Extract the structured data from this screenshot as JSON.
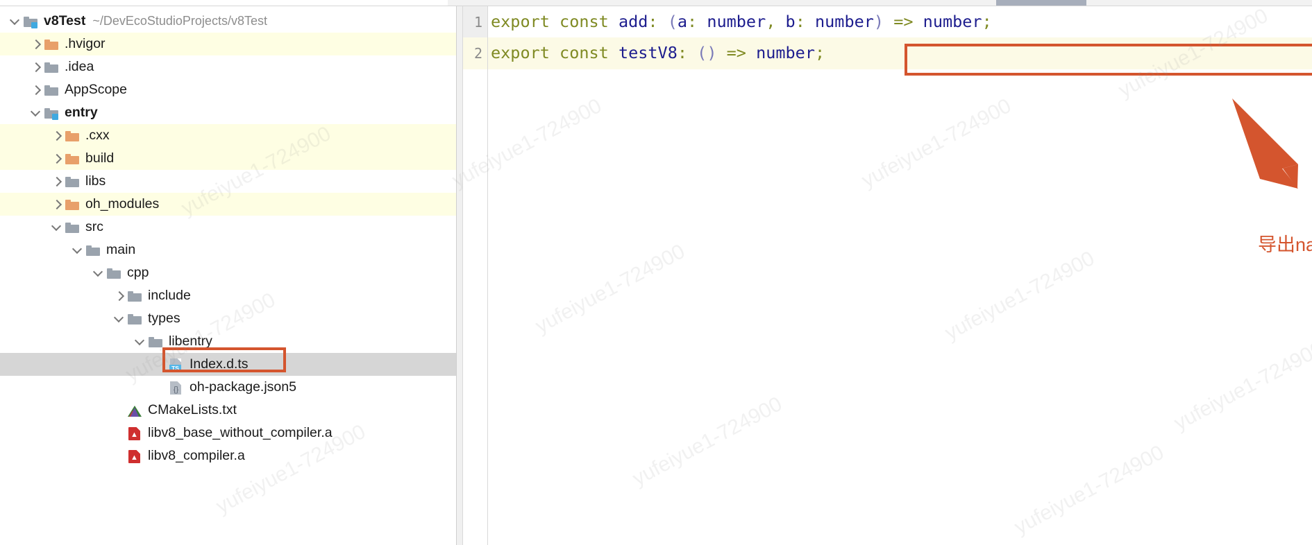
{
  "window": {
    "scrollbar": "horizontal-scrollbar"
  },
  "project_tree": {
    "root": {
      "name": "v8Test",
      "path": "~/DevEcoStudioProjects/v8Test"
    },
    "items": [
      {
        "label": "v8Test",
        "path": "~/DevEcoStudioProjects/v8Test",
        "indent": 0,
        "chevron": "down",
        "icon": "module-folder-icon",
        "bold": true,
        "state": "plain"
      },
      {
        "label": ".hvigor",
        "path": "",
        "indent": 1,
        "chevron": "right",
        "icon": "folder-orange-icon",
        "bold": false,
        "state": "highlight"
      },
      {
        "label": ".idea",
        "path": "",
        "indent": 1,
        "chevron": "right",
        "icon": "folder-gray-icon",
        "bold": false,
        "state": "plain"
      },
      {
        "label": "AppScope",
        "path": "",
        "indent": 1,
        "chevron": "right",
        "icon": "folder-gray-icon",
        "bold": false,
        "state": "plain"
      },
      {
        "label": "entry",
        "path": "",
        "indent": 1,
        "chevron": "down",
        "icon": "module-folder-icon",
        "bold": true,
        "state": "plain"
      },
      {
        "label": ".cxx",
        "path": "",
        "indent": 2,
        "chevron": "right",
        "icon": "folder-orange-icon",
        "bold": false,
        "state": "highlight"
      },
      {
        "label": "build",
        "path": "",
        "indent": 2,
        "chevron": "right",
        "icon": "folder-orange-icon",
        "bold": false,
        "state": "highlight"
      },
      {
        "label": "libs",
        "path": "",
        "indent": 2,
        "chevron": "right",
        "icon": "folder-gray-icon",
        "bold": false,
        "state": "plain"
      },
      {
        "label": "oh_modules",
        "path": "",
        "indent": 2,
        "chevron": "right",
        "icon": "folder-orange-icon",
        "bold": false,
        "state": "highlight"
      },
      {
        "label": "src",
        "path": "",
        "indent": 2,
        "chevron": "down",
        "icon": "folder-gray-icon",
        "bold": false,
        "state": "plain"
      },
      {
        "label": "main",
        "path": "",
        "indent": 3,
        "chevron": "down",
        "icon": "folder-gray-icon",
        "bold": false,
        "state": "plain"
      },
      {
        "label": "cpp",
        "path": "",
        "indent": 4,
        "chevron": "down",
        "icon": "folder-gray-icon",
        "bold": false,
        "state": "plain"
      },
      {
        "label": "include",
        "path": "",
        "indent": 5,
        "chevron": "right",
        "icon": "folder-gray-icon",
        "bold": false,
        "state": "plain"
      },
      {
        "label": "types",
        "path": "",
        "indent": 5,
        "chevron": "down",
        "icon": "folder-gray-icon",
        "bold": false,
        "state": "plain"
      },
      {
        "label": "libentry",
        "path": "",
        "indent": 6,
        "chevron": "down",
        "icon": "folder-gray-icon",
        "bold": false,
        "state": "plain"
      },
      {
        "label": "Index.d.ts",
        "path": "",
        "indent": 7,
        "chevron": "none",
        "icon": "typescript-file-icon",
        "bold": false,
        "state": "selected"
      },
      {
        "label": "oh-package.json5",
        "path": "",
        "indent": 7,
        "chevron": "none",
        "icon": "json5-file-icon",
        "bold": false,
        "state": "plain"
      },
      {
        "label": "CMakeLists.txt",
        "path": "",
        "indent": 5,
        "chevron": "none",
        "icon": "cmake-file-icon",
        "bold": false,
        "state": "plain"
      },
      {
        "label": "libv8_base_without_compiler.a",
        "path": "",
        "indent": 5,
        "chevron": "none",
        "icon": "archive-file-icon",
        "bold": false,
        "state": "plain"
      },
      {
        "label": "libv8_compiler.a",
        "path": "",
        "indent": 5,
        "chevron": "none",
        "icon": "archive-file-icon",
        "bold": false,
        "state": "plain"
      }
    ]
  },
  "editor": {
    "line_numbers": [
      "1",
      "2"
    ],
    "lines": [
      {
        "number": "1",
        "text": "export const add: (a: number, b: number) => number;",
        "tokens": [
          {
            "t": "export",
            "k": "kw"
          },
          {
            "t": " ",
            "k": "plain"
          },
          {
            "t": "const",
            "k": "kw"
          },
          {
            "t": " ",
            "k": "plain"
          },
          {
            "t": "add",
            "k": "id"
          },
          {
            "t": ":",
            "k": "op"
          },
          {
            "t": " ",
            "k": "plain"
          },
          {
            "t": "(",
            "k": "punct"
          },
          {
            "t": "a",
            "k": "id"
          },
          {
            "t": ":",
            "k": "op"
          },
          {
            "t": " ",
            "k": "plain"
          },
          {
            "t": "number",
            "k": "id"
          },
          {
            "t": ",",
            "k": "op"
          },
          {
            "t": " ",
            "k": "plain"
          },
          {
            "t": "b",
            "k": "id"
          },
          {
            "t": ":",
            "k": "op"
          },
          {
            "t": " ",
            "k": "plain"
          },
          {
            "t": "number",
            "k": "id"
          },
          {
            "t": ")",
            "k": "punct"
          },
          {
            "t": " ",
            "k": "plain"
          },
          {
            "t": "=>",
            "k": "op"
          },
          {
            "t": " ",
            "k": "plain"
          },
          {
            "t": "number",
            "k": "id"
          },
          {
            "t": ";",
            "k": "op"
          }
        ]
      },
      {
        "number": "2",
        "text": "export const testV8: () => number;",
        "tokens": [
          {
            "t": "export",
            "k": "kw"
          },
          {
            "t": " ",
            "k": "plain"
          },
          {
            "t": "const",
            "k": "kw"
          },
          {
            "t": " ",
            "k": "plain"
          },
          {
            "t": "testV8",
            "k": "id"
          },
          {
            "t": ":",
            "k": "op"
          },
          {
            "t": " ",
            "k": "plain"
          },
          {
            "t": "(",
            "k": "punct"
          },
          {
            "t": ")",
            "k": "punct"
          },
          {
            "t": " ",
            "k": "plain"
          },
          {
            "t": "=>",
            "k": "op"
          },
          {
            "t": " ",
            "k": "plain"
          },
          {
            "t": "number",
            "k": "id"
          },
          {
            "t": ";",
            "k": "op"
          }
        ]
      }
    ]
  },
  "annotations": {
    "note_text": "导出napi给artTs用",
    "accent_color": "#d4552e",
    "code_box_target": "export const testV8: () => number;",
    "tree_box_target": "Index.d.ts"
  },
  "watermarks": [
    "yufeiyue1-724900",
    "yufeiyue1-724900",
    "yufeiyue1-724900",
    "yufeiyue1-724900",
    "yufeiyue1-724900",
    "yufeiyue1-724900",
    "yufeiyue1-724900",
    "yufeiyue1-724900"
  ],
  "colors": {
    "highlight_row": "#FEFEE3",
    "selected_row": "#d6d6d6",
    "keyword": "#7f8a23",
    "identifier": "#1d1d8e",
    "paren": "#7a7ab8",
    "accent": "#d4552e"
  }
}
